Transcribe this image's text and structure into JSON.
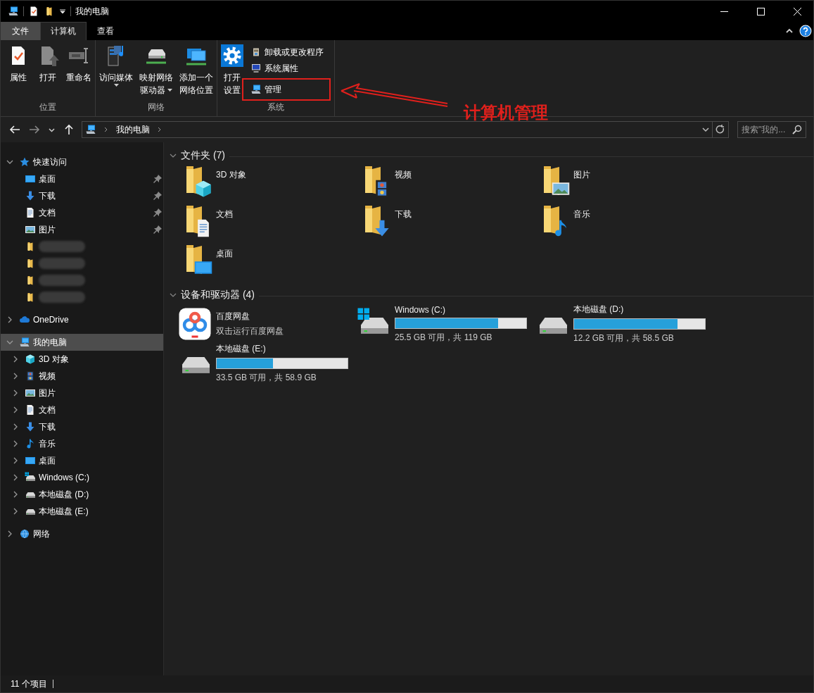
{
  "window": {
    "title": "我的电脑"
  },
  "ribbon_tabs": [
    {
      "label": "文件",
      "kind": "file",
      "selected": false
    },
    {
      "label": "计算机",
      "kind": "tab",
      "selected": true
    },
    {
      "label": "查看",
      "kind": "tab",
      "selected": false
    }
  ],
  "ribbon_groups": [
    {
      "label": "位置",
      "commands": [
        {
          "lines": [
            "属性"
          ],
          "kind": "properties",
          "dropdown": false
        },
        {
          "lines": [
            "打开"
          ],
          "kind": "open",
          "dropdown": false
        },
        {
          "lines": [
            "重命名"
          ],
          "kind": "rename",
          "dropdown": false
        }
      ]
    },
    {
      "label": "网络",
      "commands": [
        {
          "lines": [
            "访问媒体"
          ],
          "kind": "media",
          "dropdown": true
        },
        {
          "lines": [
            "映射网络",
            "驱动器"
          ],
          "kind": "mapdrive",
          "dropdown": true
        },
        {
          "lines": [
            "添加一个",
            "网络位置"
          ],
          "kind": "netplace",
          "dropdown": false
        }
      ]
    },
    {
      "label": "系统",
      "commands": [
        {
          "lines": [
            "打开",
            "设置"
          ],
          "kind": "settings",
          "dropdown": false
        }
      ],
      "small_commands": [
        {
          "label": "卸载或更改程序",
          "kind": "programs"
        },
        {
          "label": "系统属性",
          "kind": "sysprops"
        },
        {
          "label": "管理",
          "kind": "manage"
        }
      ]
    }
  ],
  "address": {
    "crumbs": [
      "我的电脑"
    ]
  },
  "search": {
    "placeholder": "搜索\"我的..."
  },
  "sidebar": {
    "tree": [
      {
        "label": "快速访问",
        "kind": "star",
        "expanded": true,
        "selected": false,
        "children": [
          {
            "label": "桌面",
            "kind": "desktop",
            "pinned": true,
            "selected": false
          },
          {
            "label": "下载",
            "kind": "download",
            "pinned": true,
            "selected": false
          },
          {
            "label": "文档",
            "kind": "document",
            "pinned": true,
            "selected": false
          },
          {
            "label": "图片",
            "kind": "picture",
            "pinned": true,
            "selected": false
          },
          {
            "kind": "folder",
            "blurred": true,
            "pinned": false,
            "selected": false
          },
          {
            "kind": "folder",
            "blurred": true,
            "pinned": false,
            "selected": false
          },
          {
            "kind": "folder",
            "blurred": true,
            "pinned": false,
            "selected": false
          },
          {
            "kind": "folder",
            "blurred": true,
            "pinned": false,
            "selected": false
          }
        ]
      },
      {
        "label": "OneDrive",
        "kind": "cloud",
        "expanded": false,
        "selected": false
      },
      {
        "label": "我的电脑",
        "kind": "pc",
        "expanded": true,
        "selected": true,
        "children": [
          {
            "label": "3D 对象",
            "kind": "objects",
            "expanded": false,
            "selected": false
          },
          {
            "label": "视频",
            "kind": "video",
            "expanded": false,
            "selected": false
          },
          {
            "label": "图片",
            "kind": "picture",
            "expanded": false,
            "selected": false
          },
          {
            "label": "文档",
            "kind": "document",
            "expanded": false,
            "selected": false
          },
          {
            "label": "下载",
            "kind": "download",
            "expanded": false,
            "selected": false
          },
          {
            "label": "音乐",
            "kind": "music",
            "expanded": false,
            "selected": false
          },
          {
            "label": "桌面",
            "kind": "desktop",
            "expanded": false,
            "selected": false
          },
          {
            "label": "Windows (C:)",
            "kind": "sysdrive",
            "expanded": false,
            "selected": false
          },
          {
            "label": "本地磁盘 (D:)",
            "kind": "drive",
            "expanded": false,
            "selected": false
          },
          {
            "label": "本地磁盘 (E:)",
            "kind": "drive",
            "expanded": false,
            "selected": false
          }
        ]
      },
      {
        "label": "网络",
        "kind": "network",
        "expanded": false,
        "selected": false
      }
    ]
  },
  "sections": [
    {
      "title": "文件夹 (7)",
      "expanded": true,
      "items": [
        {
          "label": "3D 对象",
          "kind": "objects"
        },
        {
          "label": "视频",
          "kind": "video"
        },
        {
          "label": "图片",
          "kind": "picture"
        },
        {
          "label": "文档",
          "kind": "document"
        },
        {
          "label": "下载",
          "kind": "download"
        },
        {
          "label": "音乐",
          "kind": "music"
        },
        {
          "label": "桌面",
          "kind": "desktop"
        }
      ]
    },
    {
      "title": "设备和驱动器 (4)",
      "expanded": true,
      "items": [
        {
          "label": "百度网盘",
          "kind": "app",
          "subtitle": "双击运行百度网盘"
        },
        {
          "label": "Windows (C:)",
          "kind": "sysdrive",
          "level": 0.786,
          "reading": "25.5 GB 可用，共 119 GB"
        },
        {
          "label": "本地磁盘 (D:)",
          "kind": "drive",
          "level": 0.79,
          "reading": "12.2 GB 可用，共 58.5 GB"
        },
        {
          "label": "本地磁盘 (E:)",
          "kind": "drive",
          "level": 0.43,
          "reading": "33.5 GB 可用，共 58.9 GB"
        }
      ]
    }
  ],
  "status_bar": {
    "count": "11 个项目"
  },
  "annotation": {
    "text": "计算机管理"
  }
}
